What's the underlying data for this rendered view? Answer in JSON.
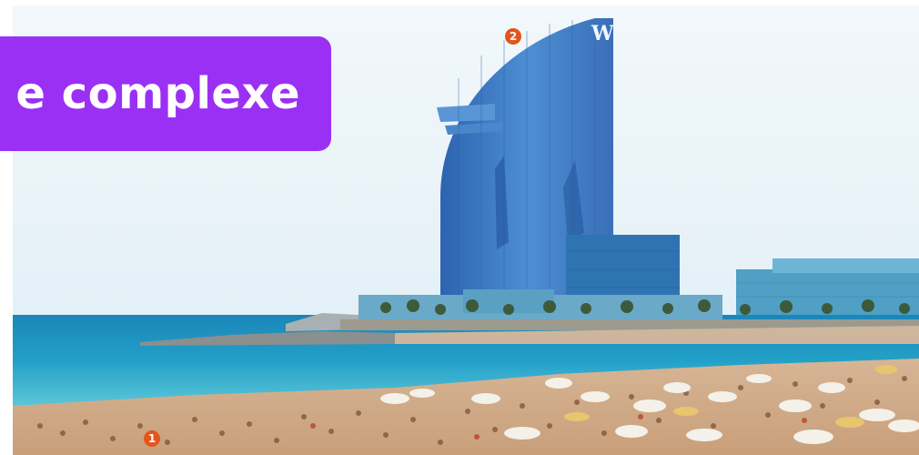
{
  "banner": {
    "text": "e complexe"
  },
  "markers": [
    {
      "label": "1"
    },
    {
      "label": "2"
    }
  ],
  "hotel": {
    "letter": "W"
  },
  "colors": {
    "banner": "#9b30f5",
    "marker": "#e2551d",
    "sky": "#eaf4f9",
    "sea": "#1f9ac4",
    "sand": "#d9b896",
    "building": "#3f7fc6"
  },
  "scene": {
    "subject": "W hotel building on a crowded beach"
  }
}
